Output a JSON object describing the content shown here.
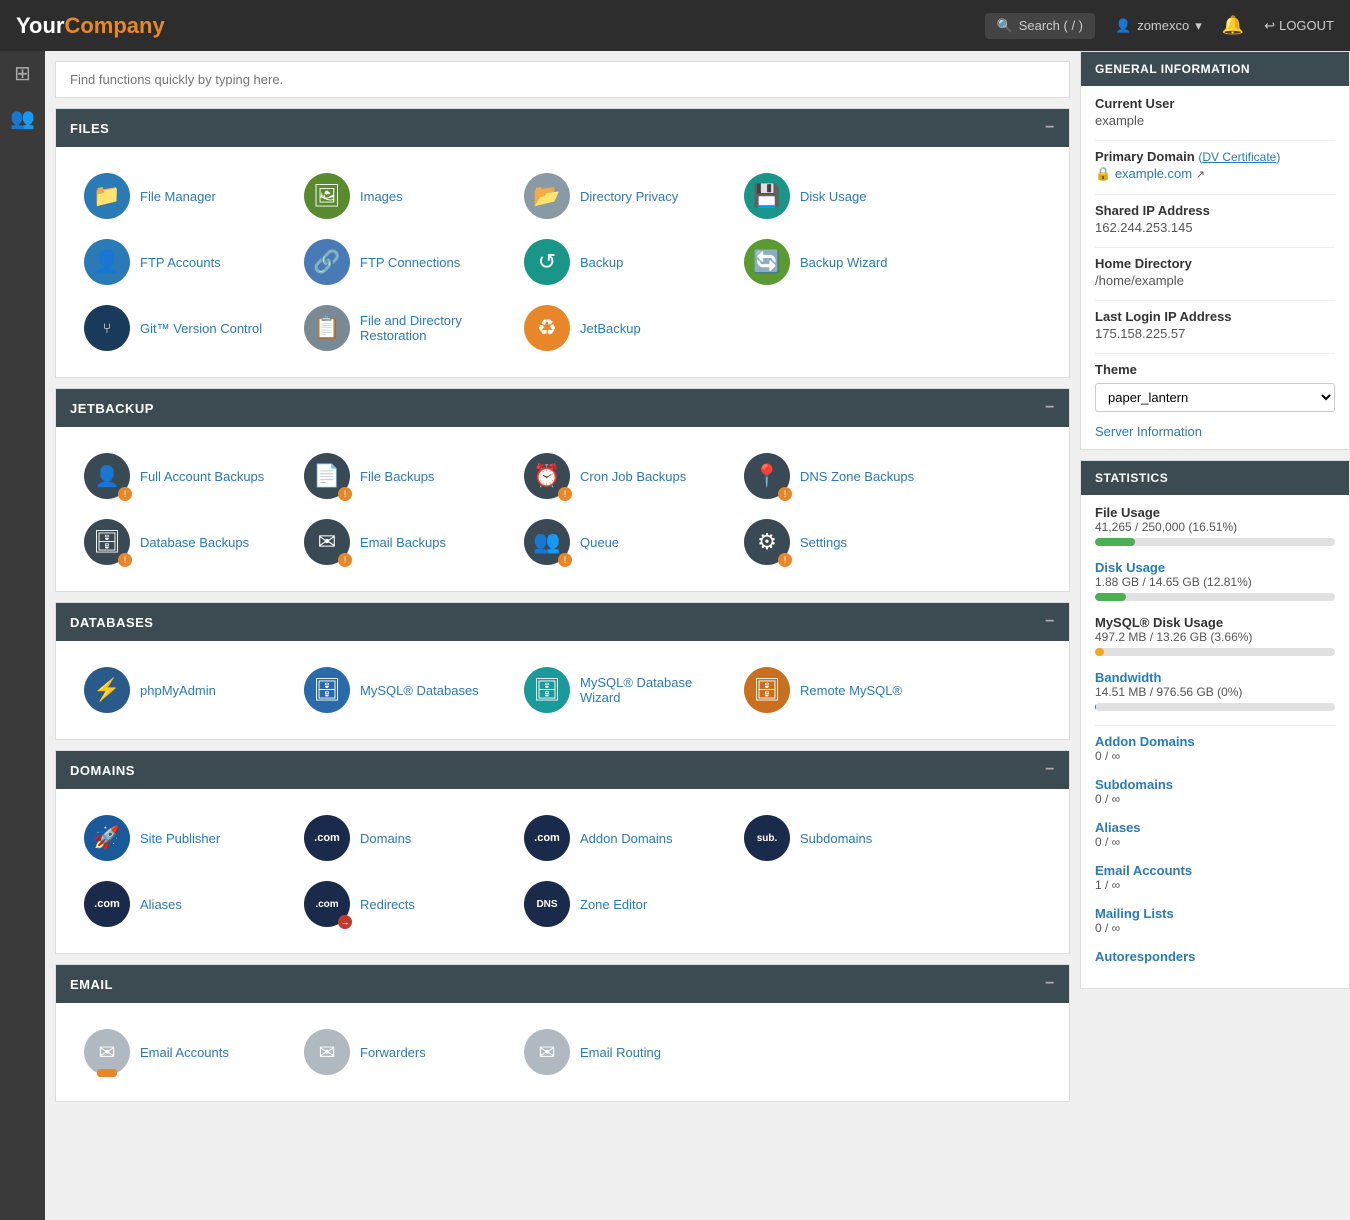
{
  "header": {
    "logo_your": "Your",
    "logo_company": "Company",
    "search_placeholder": "Search ( / )",
    "user": "zomexco",
    "logout_label": "LOGOUT"
  },
  "quickfind": {
    "placeholder": "Find functions quickly by typing here."
  },
  "sections": {
    "files": {
      "title": "FILES",
      "items": [
        {
          "label": "File Manager",
          "icon": "📁",
          "ic": "ic-blue"
        },
        {
          "label": "Images",
          "icon": "🖼",
          "ic": "ic-green"
        },
        {
          "label": "Directory Privacy",
          "icon": "📂",
          "ic": "ic-gray"
        },
        {
          "label": "Disk Usage",
          "icon": "💾",
          "ic": "ic-teal"
        },
        {
          "label": "FTP Accounts",
          "icon": "👤",
          "ic": "ic-blue"
        },
        {
          "label": "FTP Connections",
          "icon": "🔗",
          "ic": "ic-blue"
        },
        {
          "label": "Backup",
          "icon": "↺",
          "ic": "ic-teal"
        },
        {
          "label": "Backup Wizard",
          "icon": "🔄",
          "ic": "ic-green"
        },
        {
          "label": "Git™ Version Control",
          "icon": "⑂",
          "ic": "ic-navy"
        },
        {
          "label": "File and Directory Restoration",
          "icon": "📋",
          "ic": "ic-gray"
        },
        {
          "label": "JetBackup",
          "icon": "♻",
          "ic": "ic-orange"
        }
      ]
    },
    "jetbackup": {
      "title": "JETBACKUP",
      "items": [
        {
          "label": "Full Account Backups",
          "icon": "👤",
          "ic": "ic-dark"
        },
        {
          "label": "File Backups",
          "icon": "📄",
          "ic": "ic-dark"
        },
        {
          "label": "Cron Job Backups",
          "icon": "⏰",
          "ic": "ic-dark"
        },
        {
          "label": "DNS Zone Backups",
          "icon": "📍",
          "ic": "ic-dark"
        },
        {
          "label": "Database Backups",
          "icon": "🗄",
          "ic": "ic-dark"
        },
        {
          "label": "Email Backups",
          "icon": "✉",
          "ic": "ic-dark"
        },
        {
          "label": "Queue",
          "icon": "👥",
          "ic": "ic-dark"
        },
        {
          "label": "Settings",
          "icon": "⚙",
          "ic": "ic-dark"
        }
      ]
    },
    "databases": {
      "title": "DATABASES",
      "items": [
        {
          "label": "phpMyAdmin",
          "icon": "⚡",
          "ic": "ic-blue"
        },
        {
          "label": "MySQL® Databases",
          "icon": "🗄",
          "ic": "ic-blue"
        },
        {
          "label": "MySQL® Database Wizard",
          "icon": "🗄",
          "ic": "ic-teal"
        },
        {
          "label": "Remote MySQL®",
          "icon": "🗄",
          "ic": "ic-orange"
        }
      ]
    },
    "domains": {
      "title": "DOMAINS",
      "items": [
        {
          "label": "Site Publisher",
          "icon": "🚀",
          "ic": "ic-blue"
        },
        {
          "label": "Domains",
          "icon": ".com",
          "ic": "ic-navy"
        },
        {
          "label": "Addon Domains",
          "icon": ".com",
          "ic": "ic-navy"
        },
        {
          "label": "Subdomains",
          "icon": "sub.",
          "ic": "ic-navy"
        },
        {
          "label": "Aliases",
          "icon": ".com",
          "ic": "ic-navy"
        },
        {
          "label": "Redirects",
          "icon": ".com",
          "ic": "ic-navy"
        },
        {
          "label": "Zone Editor",
          "icon": "DNS",
          "ic": "ic-navy"
        }
      ]
    },
    "email": {
      "title": "EMAIL",
      "items": [
        {
          "label": "Email Accounts",
          "icon": "✉",
          "ic": "ic-light-gray"
        },
        {
          "label": "Forwarders",
          "icon": "✉",
          "ic": "ic-light-gray"
        },
        {
          "label": "Email Routing",
          "icon": "✉",
          "ic": "ic-light-gray"
        }
      ]
    }
  },
  "general_info": {
    "title": "GENERAL INFORMATION",
    "current_user_label": "Current User",
    "current_user": "example",
    "primary_domain_label": "Primary Domain",
    "dv_cert": "DV Certificate",
    "domain_link": "example.com",
    "shared_ip_label": "Shared IP Address",
    "shared_ip": "162.244.253.145",
    "home_dir_label": "Home Directory",
    "home_dir": "/home/example",
    "last_login_label": "Last Login IP Address",
    "last_login": "175.158.225.57",
    "theme_label": "Theme",
    "theme_value": "paper_lantern",
    "server_info_link": "Server Information"
  },
  "statistics": {
    "title": "STATISTICS",
    "file_usage_label": "File Usage",
    "file_usage_value": "41,265 / 250,000  (16.51%)",
    "file_usage_pct": 16.51,
    "disk_usage_label": "Disk Usage",
    "disk_usage_value": "1.88 GB / 14.65 GB  (12.81%)",
    "disk_usage_pct": 12.81,
    "mysql_label": "MySQL® Disk Usage",
    "mysql_value": "497.2 MB / 13.26 GB  (3.66%)",
    "mysql_pct": 3.66,
    "bandwidth_label": "Bandwidth",
    "bandwidth_value": "14.51 MB / 976.56 GB  (0%)",
    "bandwidth_pct": 0.01,
    "addon_domains_label": "Addon Domains",
    "addon_domains_value": "0 / ∞",
    "subdomains_label": "Subdomains",
    "subdomains_value": "0 / ∞",
    "aliases_label": "Aliases",
    "aliases_value": "0 / ∞",
    "email_accounts_label": "Email Accounts",
    "email_accounts_value": "1 / ∞",
    "mailing_lists_label": "Mailing Lists",
    "mailing_lists_value": "0 / ∞",
    "autoresponders_label": "Autoresponders"
  }
}
